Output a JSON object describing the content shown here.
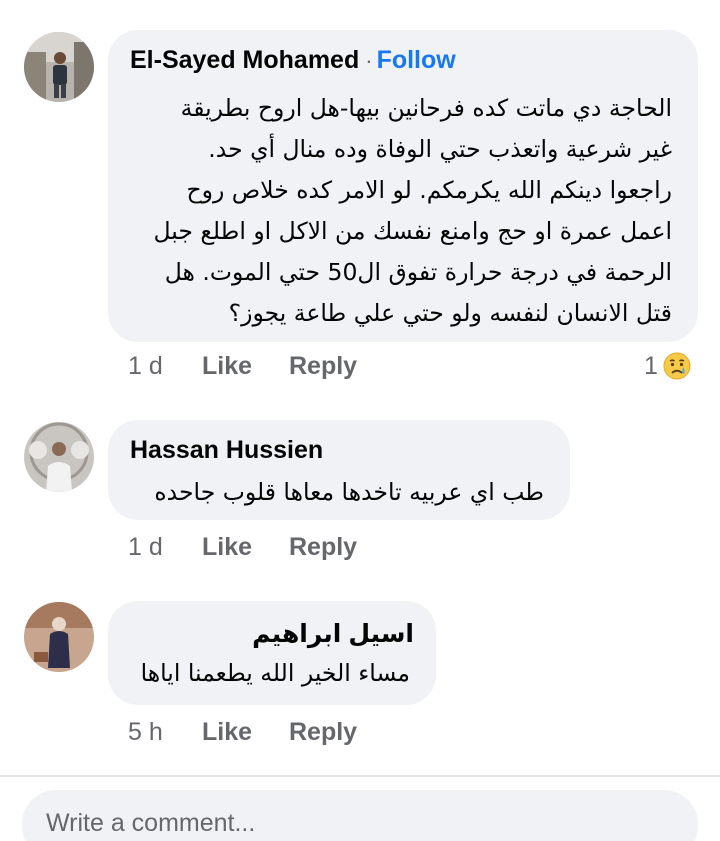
{
  "comments": [
    {
      "author": "El-Sayed Mohamed",
      "separator": "·",
      "follow_label": "Follow",
      "text_lines": [
        "الحاجة دي ماتت كده فرحانين بيها-هل اروح بطريقة",
        "غير شرعية واتعذب حتي الوفاة وده منال أي حد.",
        "راجعوا دينكم الله يكرمكم. لو الامر كده خلاص روح",
        "اعمل عمرة او حج وامنع نفسك من الاكل او اطلع جبل",
        "الرحمة في درجة حرارة تفوق ال50 حتي الموت. هل",
        "قتل الانسان لنفسه ولو حتي علي طاعة يجوز؟"
      ],
      "time": "1 d",
      "like_label": "Like",
      "reply_label": "Reply",
      "reaction_count": "1",
      "reaction_icon": "sad-crying-emoji-icon"
    },
    {
      "author": "Hassan Hussien",
      "text_lines": [
        "طب اي عربيه تاخدها معاها قلوب جاحده"
      ],
      "time": "1 d",
      "like_label": "Like",
      "reply_label": "Reply"
    },
    {
      "author": "اسيل ابراهيم",
      "text_lines": [
        "مساء الخير الله يطعمنا اياها"
      ],
      "time": "5 h",
      "like_label": "Like",
      "reply_label": "Reply"
    }
  ],
  "composer": {
    "placeholder": "Write a comment..."
  },
  "colors": {
    "bubble_bg": "#f0f2f5",
    "follow_blue": "#1877f2",
    "meta_gray": "#65676b",
    "text": "#050505"
  }
}
